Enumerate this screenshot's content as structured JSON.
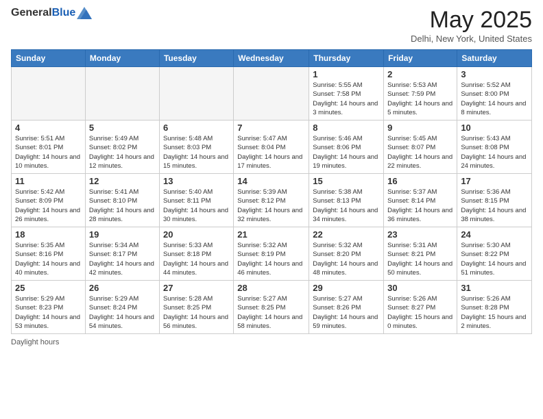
{
  "header": {
    "logo_general": "General",
    "logo_blue": "Blue",
    "month_title": "May 2025",
    "location": "Delhi, New York, United States"
  },
  "calendar": {
    "days_of_week": [
      "Sunday",
      "Monday",
      "Tuesday",
      "Wednesday",
      "Thursday",
      "Friday",
      "Saturday"
    ],
    "weeks": [
      [
        {
          "day": "",
          "info": ""
        },
        {
          "day": "",
          "info": ""
        },
        {
          "day": "",
          "info": ""
        },
        {
          "day": "",
          "info": ""
        },
        {
          "day": "1",
          "info": "Sunrise: 5:55 AM\nSunset: 7:58 PM\nDaylight: 14 hours and 3 minutes."
        },
        {
          "day": "2",
          "info": "Sunrise: 5:53 AM\nSunset: 7:59 PM\nDaylight: 14 hours and 5 minutes."
        },
        {
          "day": "3",
          "info": "Sunrise: 5:52 AM\nSunset: 8:00 PM\nDaylight: 14 hours and 8 minutes."
        }
      ],
      [
        {
          "day": "4",
          "info": "Sunrise: 5:51 AM\nSunset: 8:01 PM\nDaylight: 14 hours and 10 minutes."
        },
        {
          "day": "5",
          "info": "Sunrise: 5:49 AM\nSunset: 8:02 PM\nDaylight: 14 hours and 12 minutes."
        },
        {
          "day": "6",
          "info": "Sunrise: 5:48 AM\nSunset: 8:03 PM\nDaylight: 14 hours and 15 minutes."
        },
        {
          "day": "7",
          "info": "Sunrise: 5:47 AM\nSunset: 8:04 PM\nDaylight: 14 hours and 17 minutes."
        },
        {
          "day": "8",
          "info": "Sunrise: 5:46 AM\nSunset: 8:06 PM\nDaylight: 14 hours and 19 minutes."
        },
        {
          "day": "9",
          "info": "Sunrise: 5:45 AM\nSunset: 8:07 PM\nDaylight: 14 hours and 22 minutes."
        },
        {
          "day": "10",
          "info": "Sunrise: 5:43 AM\nSunset: 8:08 PM\nDaylight: 14 hours and 24 minutes."
        }
      ],
      [
        {
          "day": "11",
          "info": "Sunrise: 5:42 AM\nSunset: 8:09 PM\nDaylight: 14 hours and 26 minutes."
        },
        {
          "day": "12",
          "info": "Sunrise: 5:41 AM\nSunset: 8:10 PM\nDaylight: 14 hours and 28 minutes."
        },
        {
          "day": "13",
          "info": "Sunrise: 5:40 AM\nSunset: 8:11 PM\nDaylight: 14 hours and 30 minutes."
        },
        {
          "day": "14",
          "info": "Sunrise: 5:39 AM\nSunset: 8:12 PM\nDaylight: 14 hours and 32 minutes."
        },
        {
          "day": "15",
          "info": "Sunrise: 5:38 AM\nSunset: 8:13 PM\nDaylight: 14 hours and 34 minutes."
        },
        {
          "day": "16",
          "info": "Sunrise: 5:37 AM\nSunset: 8:14 PM\nDaylight: 14 hours and 36 minutes."
        },
        {
          "day": "17",
          "info": "Sunrise: 5:36 AM\nSunset: 8:15 PM\nDaylight: 14 hours and 38 minutes."
        }
      ],
      [
        {
          "day": "18",
          "info": "Sunrise: 5:35 AM\nSunset: 8:16 PM\nDaylight: 14 hours and 40 minutes."
        },
        {
          "day": "19",
          "info": "Sunrise: 5:34 AM\nSunset: 8:17 PM\nDaylight: 14 hours and 42 minutes."
        },
        {
          "day": "20",
          "info": "Sunrise: 5:33 AM\nSunset: 8:18 PM\nDaylight: 14 hours and 44 minutes."
        },
        {
          "day": "21",
          "info": "Sunrise: 5:32 AM\nSunset: 8:19 PM\nDaylight: 14 hours and 46 minutes."
        },
        {
          "day": "22",
          "info": "Sunrise: 5:32 AM\nSunset: 8:20 PM\nDaylight: 14 hours and 48 minutes."
        },
        {
          "day": "23",
          "info": "Sunrise: 5:31 AM\nSunset: 8:21 PM\nDaylight: 14 hours and 50 minutes."
        },
        {
          "day": "24",
          "info": "Sunrise: 5:30 AM\nSunset: 8:22 PM\nDaylight: 14 hours and 51 minutes."
        }
      ],
      [
        {
          "day": "25",
          "info": "Sunrise: 5:29 AM\nSunset: 8:23 PM\nDaylight: 14 hours and 53 minutes."
        },
        {
          "day": "26",
          "info": "Sunrise: 5:29 AM\nSunset: 8:24 PM\nDaylight: 14 hours and 54 minutes."
        },
        {
          "day": "27",
          "info": "Sunrise: 5:28 AM\nSunset: 8:25 PM\nDaylight: 14 hours and 56 minutes."
        },
        {
          "day": "28",
          "info": "Sunrise: 5:27 AM\nSunset: 8:25 PM\nDaylight: 14 hours and 58 minutes."
        },
        {
          "day": "29",
          "info": "Sunrise: 5:27 AM\nSunset: 8:26 PM\nDaylight: 14 hours and 59 minutes."
        },
        {
          "day": "30",
          "info": "Sunrise: 5:26 AM\nSunset: 8:27 PM\nDaylight: 15 hours and 0 minutes."
        },
        {
          "day": "31",
          "info": "Sunrise: 5:26 AM\nSunset: 8:28 PM\nDaylight: 15 hours and 2 minutes."
        }
      ]
    ]
  },
  "footer": {
    "daylight_label": "Daylight hours"
  }
}
